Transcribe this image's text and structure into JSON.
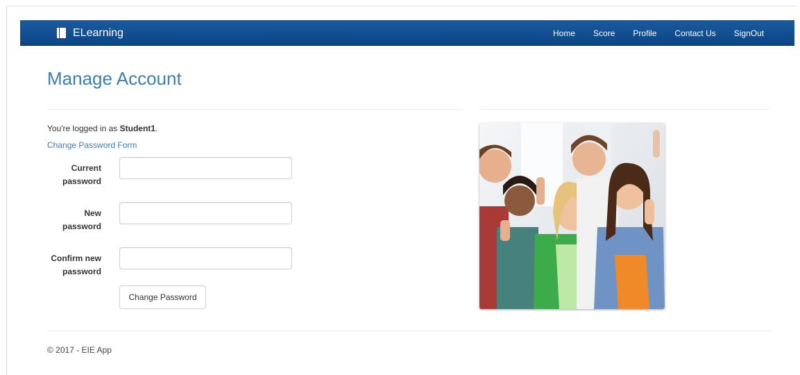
{
  "app": {
    "brand": "ELearning"
  },
  "nav": {
    "items": [
      {
        "label": "Home"
      },
      {
        "label": "Score"
      },
      {
        "label": "Profile"
      },
      {
        "label": "Contact Us"
      },
      {
        "label": "SignOut"
      }
    ]
  },
  "page": {
    "title": "Manage Account",
    "logged_prefix": "You're logged in as ",
    "username": "Student1",
    "logged_suffix": ".",
    "form_title": "Change Password Form"
  },
  "form": {
    "fields": [
      {
        "label_line1": "Current",
        "label_line2": "password",
        "value": ""
      },
      {
        "label_line1": "New",
        "label_line2": "password",
        "value": ""
      },
      {
        "label_line1": "Confirm new",
        "label_line2": "password",
        "value": ""
      }
    ],
    "submit_label": "Change Password"
  },
  "footer": {
    "text": "© 2017 - EIE App"
  },
  "colors": {
    "navbar": "#0c4584",
    "link": "#3b7fb0"
  },
  "icons": {
    "brand": "book-icon"
  }
}
